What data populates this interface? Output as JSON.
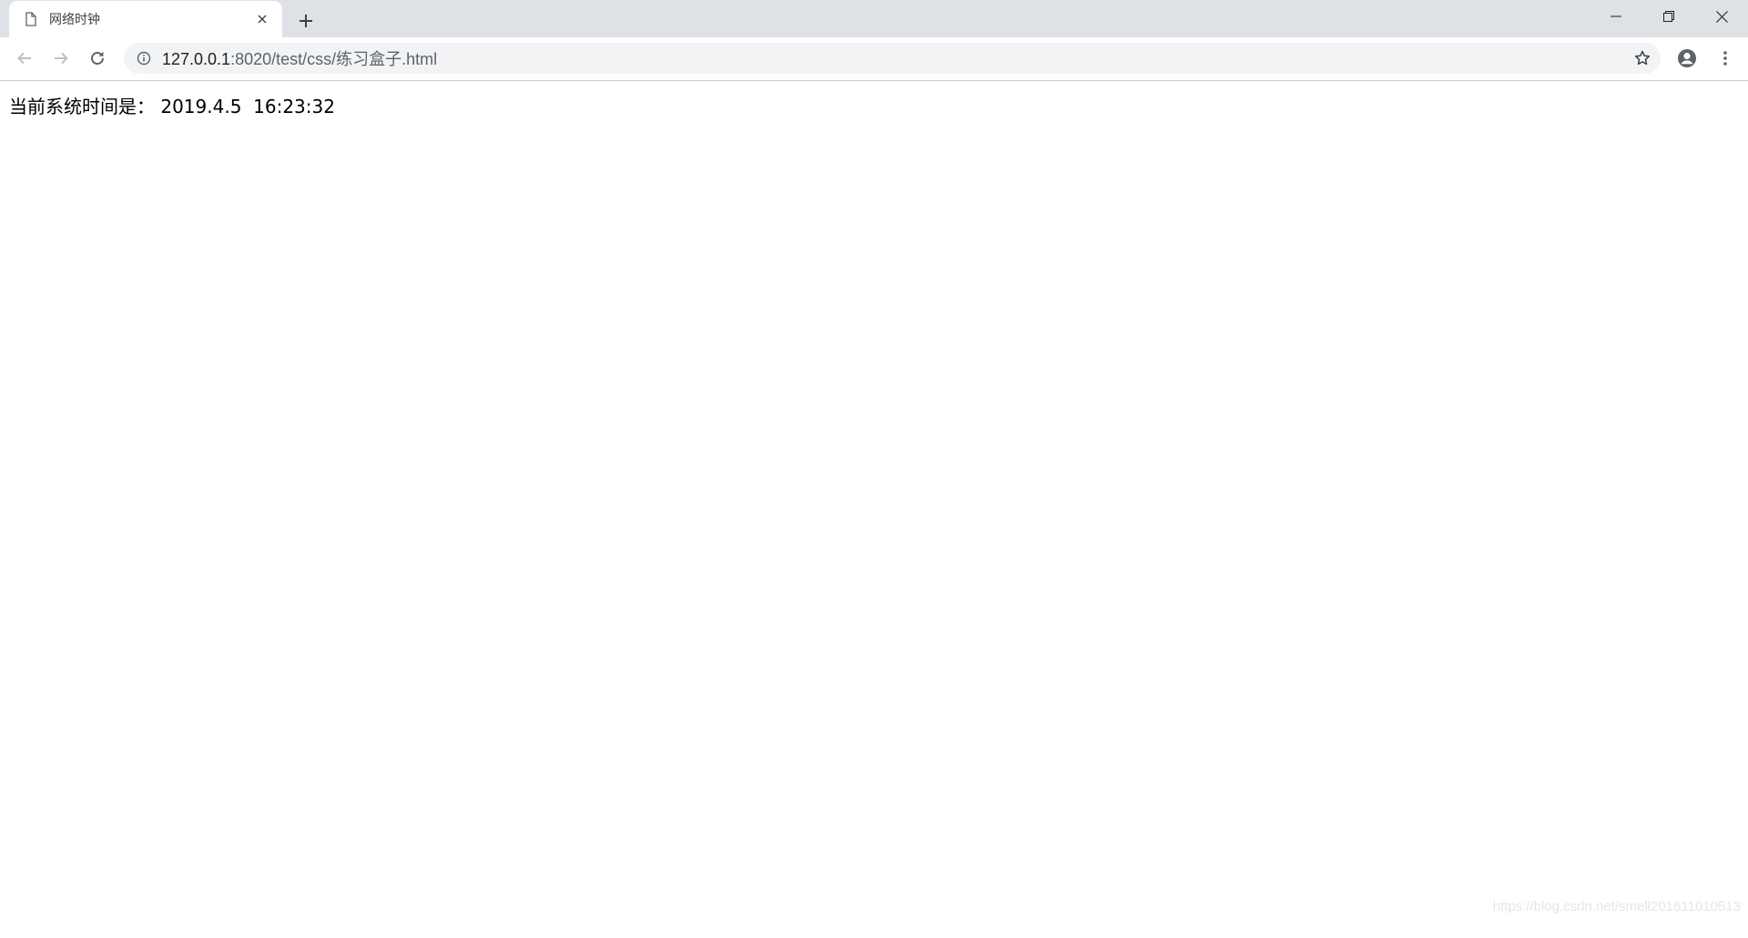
{
  "browser": {
    "tab": {
      "title": "网络时钟",
      "icon": "file-icon"
    },
    "new_tab_icon": "plus-icon",
    "window_controls": [
      "minimize-icon",
      "restore-icon",
      "close-icon"
    ],
    "address": {
      "host": "127.0.0.1",
      "path": ":8020/test/css/练习盒子.html"
    }
  },
  "page": {
    "clock_label": "当前系统时间是：",
    "date": "2019.4.5",
    "time": "16:23:32",
    "watermark": "https://blog.csdn.net/smell201611010513"
  },
  "colors": {
    "tabstrip": "#dee1e6",
    "omnibox": "#f1f3f4",
    "url_path": "#5f6368"
  }
}
